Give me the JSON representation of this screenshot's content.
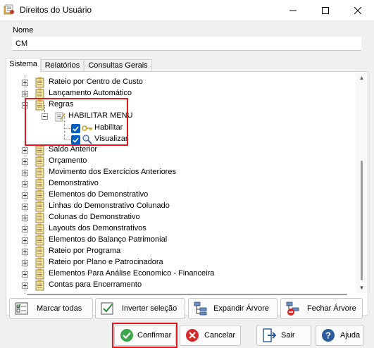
{
  "window": {
    "title": "Direitos do Usuário"
  },
  "form": {
    "nome_label": "Nome",
    "nome_value": "CM"
  },
  "tabs": [
    {
      "label": "Sistema"
    },
    {
      "label": "Relatórios"
    },
    {
      "label": "Consultas Gerais"
    }
  ],
  "tree": {
    "items": [
      {
        "label": "Rateio por Centro de Custo"
      },
      {
        "label": "Lançamento Automático"
      },
      {
        "label": "Regras"
      },
      {
        "label": "HABILITAR MENU"
      },
      {
        "label": "Habilitar"
      },
      {
        "label": "Visualizar"
      },
      {
        "label": "Saldo Anterior"
      },
      {
        "label": "Orçamento"
      },
      {
        "label": "Movimento dos Exercícios Anteriores"
      },
      {
        "label": "Demonstrativo"
      },
      {
        "label": "Elementos do Demonstrativo"
      },
      {
        "label": "Linhas do Demonstrativo Colunado"
      },
      {
        "label": "Colunas do Demonstrativo"
      },
      {
        "label": "Layouts dos Demonstrativos"
      },
      {
        "label": "Elementos do Balanço Patrimonial"
      },
      {
        "label": "Rateio por Programa"
      },
      {
        "label": "Rateio por Plano e Patrocinadora"
      },
      {
        "label": "Elementos Para Análise Economico - Financeira"
      },
      {
        "label": "Contas para Encerramento"
      }
    ]
  },
  "actions": {
    "marcar_todas": "Marcar todas",
    "inverter_selecao": "Inverter seleção",
    "expandir_arvore": "Expandir Árvore",
    "fechar_arvore": "Fechar Árvore"
  },
  "footer": {
    "confirmar": "Confirmar",
    "cancelar": "Cancelar",
    "sair": "Sair",
    "ajuda": "Ajuda"
  },
  "colors": {
    "accent_blue": "#0060c0",
    "highlight_red": "#e0181f",
    "confirm_green": "#3aa84a",
    "cancel_red": "#d42a2a"
  }
}
